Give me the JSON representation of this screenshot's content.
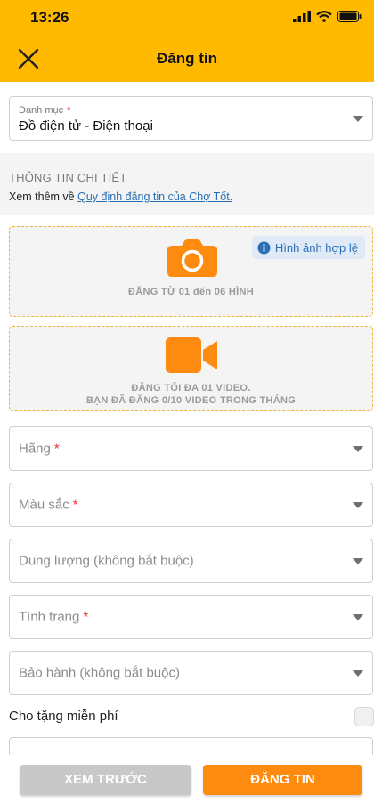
{
  "status_bar": {
    "time": "13:26"
  },
  "header": {
    "title": "Đăng tin"
  },
  "category": {
    "label": "Danh mục",
    "required": "*",
    "value": "Đồ điện tử - Điện thoại"
  },
  "details": {
    "title": "THÔNG TIN CHI TIẾT",
    "note_prefix": "Xem thêm về ",
    "note_link": "Quy định đăng tin của Chợ Tốt."
  },
  "photo_upload": {
    "text": "ĐĂNG TỪ 01 đến 06 HÌNH",
    "valid_badge": "Hình ảnh hợp lệ"
  },
  "video_upload": {
    "line1": "ĐĂNG TỐI ĐA 01 VIDEO.",
    "line2": "BẠN ĐÃ ĐĂNG 0/10 VIDEO TRONG THÁNG"
  },
  "fields": [
    {
      "placeholder": "Hãng",
      "required": "*"
    },
    {
      "placeholder": "Màu sắc",
      "required": "*"
    },
    {
      "placeholder": "Dung lượng (không bắt buộc)",
      "required": ""
    },
    {
      "placeholder": "Tình trạng",
      "required": "*"
    },
    {
      "placeholder": "Bảo hành (không bắt buộc)",
      "required": ""
    }
  ],
  "free_gift": {
    "label": "Cho tặng miễn phí",
    "checked": false
  },
  "buttons": {
    "preview": "XEM TRƯỚC",
    "post": "ĐĂNG TIN"
  },
  "colors": {
    "brand": "#ffba00",
    "primary_button": "#fd8b10",
    "link": "#2a6fb5",
    "required": "#e5332a"
  }
}
